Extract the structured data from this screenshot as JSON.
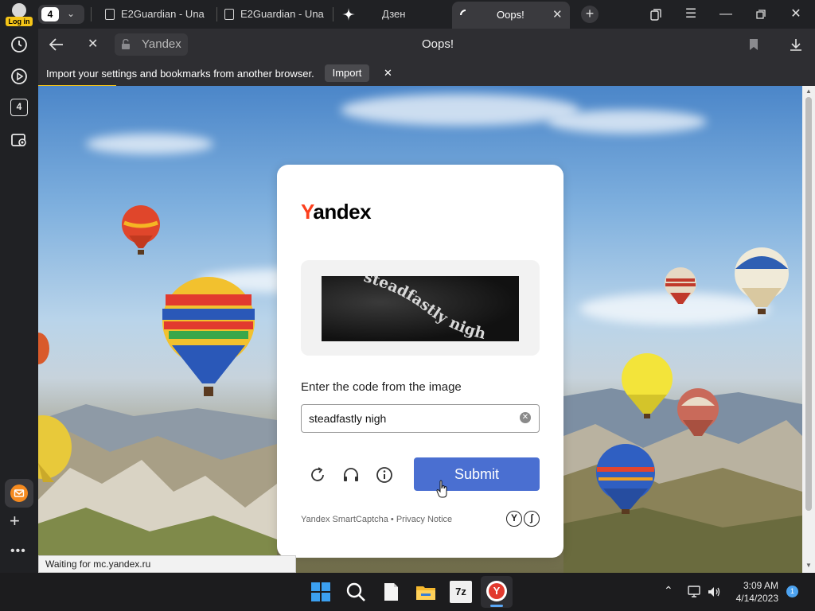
{
  "profile": {
    "login_label": "Log in",
    "tab_count": "4"
  },
  "tabs": [
    {
      "title": "E2Guardian - Una"
    },
    {
      "title": "E2Guardian - Una"
    },
    {
      "title": "Дзен"
    },
    {
      "title": "Oops!"
    }
  ],
  "sidebar": {
    "tabs_count": "4"
  },
  "toolbar": {
    "site_label": "Yandex",
    "page_title": "Oops!"
  },
  "infobar": {
    "message": "Import your settings and bookmarks from another browser.",
    "import_label": "Import"
  },
  "captcha": {
    "logo_first": "Y",
    "logo_rest": "andex",
    "image_text": "steadfastly nigh",
    "instruction": "Enter the code from the image",
    "input_value": "steadfastly nigh",
    "submit_label": "Submit",
    "footer_brand": "Yandex SmartCaptcha",
    "footer_sep": " • ",
    "footer_link": "Privacy Notice"
  },
  "status": {
    "text": "Waiting for mc.yandex.ru"
  },
  "taskbar": {
    "time": "3:09 AM",
    "date": "4/14/2023",
    "notifications": "1"
  },
  "colors": {
    "accent": "#f5c518",
    "submit": "#4a6fd1",
    "yandex_red": "#fc3f1d"
  }
}
